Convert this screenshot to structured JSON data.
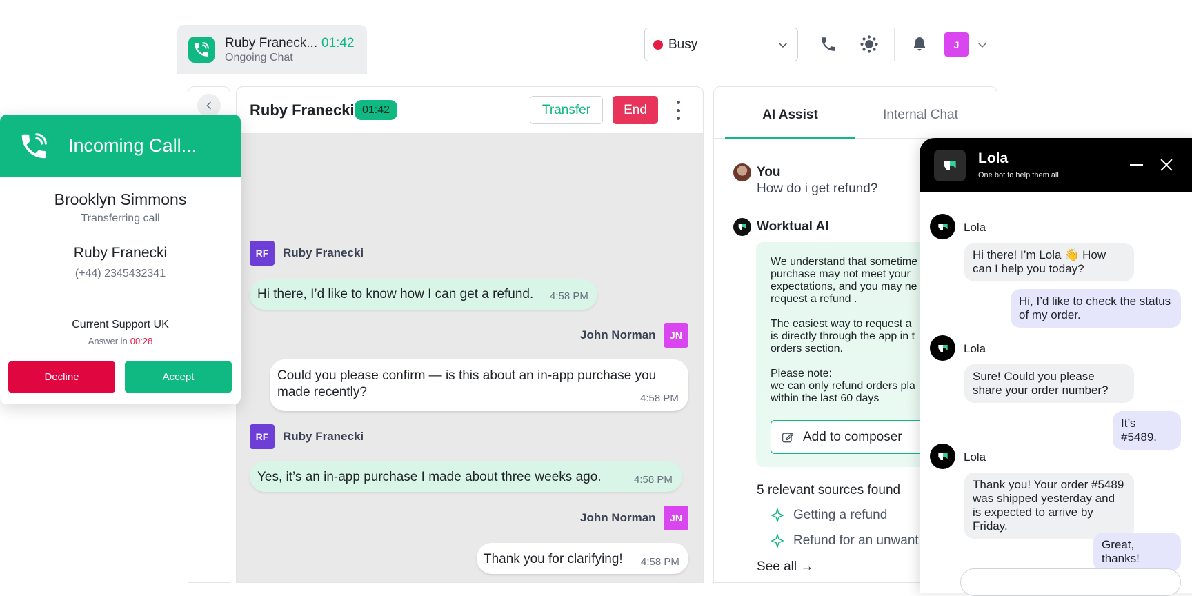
{
  "topbar": {
    "active_tab": {
      "name": "Ruby Franeck...",
      "timer": "01:42",
      "subtitle": "Ongoing Chat"
    },
    "status": {
      "label": "Busy",
      "color": "#e11d48"
    },
    "user_initial": "J"
  },
  "chat": {
    "title": "Ruby Franecki",
    "timer": "01:42",
    "transfer_label": "Transfer",
    "end_label": "End",
    "messages": [
      {
        "sender": "Ruby Franecki",
        "initials": "RF",
        "text": "Hi there, I’d like to know how I can get a refund.",
        "time": "4:58 PM"
      },
      {
        "sender": "John Norman",
        "initials": "JN",
        "text": "Could you please confirm — is this about an in-app purchase you made recently?",
        "time": "4:58 PM"
      },
      {
        "sender": "Ruby Franecki",
        "initials": "RF",
        "text": "Yes, it’s an in-app purchase I made about three weeks ago.",
        "time": "4:58 PM"
      },
      {
        "sender": "John Norman",
        "initials": "JN",
        "text": "Thank you for clarifying!",
        "time": "4:58 PM"
      }
    ]
  },
  "ai_panel": {
    "tabs": [
      "AI Assist",
      "Internal Chat"
    ],
    "you_label": "You",
    "question": "How do i get refund?",
    "ai_name": "Worktual AI",
    "answer": "We understand that sometime\npurchase may not meet your\nexpectations, and you may ne\nrequest a refund .\n\nThe easiest way to request a\nis directly through the app in t\norders section.\n\nPlease note:\nwe can only refund orders pla\nwithin the last 60 days",
    "add_to_composer": "Add to composer",
    "sources_title": "5 relevant sources found",
    "sources": [
      "Getting a refund",
      "Refund for an unwant"
    ],
    "see_all": "See all"
  },
  "lola": {
    "title": "Lola",
    "subtitle": "One bot to help them all",
    "messages": [
      {
        "from": "bot",
        "name": "Lola",
        "text": "Hi there! I’m Lola 👋 How can I help you today?"
      },
      {
        "from": "user",
        "text": "Hi, I’d like to check the status of my order."
      },
      {
        "from": "bot",
        "name": "Lola",
        "text": "Sure! Could you please share your order number?"
      },
      {
        "from": "user",
        "text": "It’s #5489."
      },
      {
        "from": "bot",
        "name": "Lola",
        "text": "Thank you! Your order #5489 was shipped yesterday and is expected to arrive by Friday."
      },
      {
        "from": "user",
        "text": "Great, thanks!"
      }
    ]
  },
  "incoming_call": {
    "title": "Incoming Call...",
    "caller_agent": "Brooklyn Simmons",
    "caller_status": "Transferring call",
    "customer": "Ruby Franecki",
    "phone": "(+44) 2345432341",
    "queue": "Current Support UK",
    "answer_label": "Answer in",
    "answer_timer": "00:28",
    "decline_label": "Decline",
    "accept_label": "Accept"
  },
  "colors": {
    "accent": "#10b981",
    "danger": "#e8335a",
    "rf_avatar": "#6d3fd6",
    "jn_avatar": "#d946ef"
  }
}
